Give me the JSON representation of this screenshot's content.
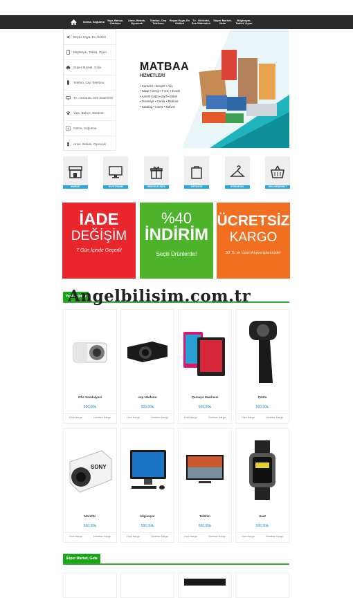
{
  "nav": {
    "items": [
      {
        "label": "Isıtma, Soğutma"
      },
      {
        "label": "Yapı, Bahçe, Outdoor"
      },
      {
        "label": "Anne, Bebek, Oyuncak"
      },
      {
        "label": "Telefon, Cep Telefonu"
      },
      {
        "label": "Beyaz Eşya, Ev Aletleri"
      },
      {
        "label": "Tv , Görüntü, Ses Sistemleri"
      },
      {
        "label": "Süper Market, Gıda"
      },
      {
        "label": "Bilgisayar, Tablet, Oyun"
      }
    ]
  },
  "sidebar": {
    "items": [
      {
        "label": "Beyaz Eşya, Ev Aletleri",
        "icon": "plane-icon"
      },
      {
        "label": "Bilgisayar, Tablet, Oyun",
        "icon": "tablet-icon"
      },
      {
        "label": "Süper Market, Gıda",
        "icon": "car-icon"
      },
      {
        "label": "Telefon, Cep Telefonu",
        "icon": "phone-icon"
      },
      {
        "label": "Tv , Görüntü, Ses Sistemleri",
        "icon": "tv-icon"
      },
      {
        "label": "Yapı, Bahçe, Outdoor",
        "icon": "paw-icon"
      },
      {
        "label": "Isıtma, Soğutma",
        "icon": "fireplace-icon"
      },
      {
        "label": "Anne, Bebek, Oyuncak",
        "icon": "baby-icon"
      }
    ]
  },
  "banner": {
    "title": "MATBAA",
    "subtitle": "HİZMETLERİ",
    "lines": [
      "• Kartvizit • Broşür • Afiş",
      "• Kitap • Dergi • Form • Evrak",
      "• Antetli Kağıt • Zarf • Etiket",
      "• Davetiye • Çanta • Bloknot",
      "• Katalog • Insert • Takvim"
    ]
  },
  "categories": [
    {
      "label": "MARKET",
      "icon": "store-icon"
    },
    {
      "label": "ELEKTRONİK",
      "icon": "monitor-icon"
    },
    {
      "label": "HEDİYELİK EŞYA",
      "icon": "gift-icon"
    },
    {
      "label": "KIRTASİYE",
      "icon": "bag-icon"
    },
    {
      "label": "GİYİM MODA",
      "icon": "hanger-icon"
    },
    {
      "label": "GIDA MEŞRUBAT",
      "icon": "basket-icon"
    }
  ],
  "promos": [
    {
      "a": "İADE",
      "b": "DEĞİŞİM",
      "c": "7 Gün İçinde Geçerli!",
      "color": "#e8262b"
    },
    {
      "a": "%40",
      "b": "İNDİRİM",
      "c": "Seçili Ürünlerde!",
      "color": "#4db32a"
    },
    {
      "a": "ÜCRETSİZ",
      "b": "KARGO",
      "c": "50 TL ve Üzeri Alışverişlerinizde!",
      "color": "#f26f22"
    }
  ],
  "watermark": "Angelbilisim.com.tr",
  "section1": {
    "title": "Yeni Ürünler"
  },
  "section2": {
    "title": "Süper Market, Gıda"
  },
  "products": [
    {
      "name": "Ofis Sandalyesi",
      "price": "500,00₺",
      "a": "Hızlı Kargo",
      "b": "Ücretsiz Kargo",
      "img": "camera-icon"
    },
    {
      "name": "cep telefonu",
      "price": "500,00₺",
      "a": "Hızlı Kargo",
      "b": "Ücretsiz Kargo",
      "img": "projector-icon"
    },
    {
      "name": "Çamaşır Makinesi",
      "price": "500,00₺",
      "a": "Hızlı Kargo",
      "b": "Ücretsiz Kargo",
      "img": "tablets-icon"
    },
    {
      "name": "Çanta",
      "price": "500,00₺",
      "a": "Hızlı Kargo",
      "b": "Ücretsiz Kargo",
      "img": "webcam-icon"
    },
    {
      "name": "Monitör",
      "price": "500,00₺",
      "a": "Hızlı Kargo",
      "b": "Ücretsiz Kargo",
      "img": "action-camera-icon"
    },
    {
      "name": "bilgisayar",
      "price": "590,00₺",
      "a": "Hızlı Kargo",
      "b": "Ücretsiz Kargo",
      "img": "all-in-one-pc-icon"
    },
    {
      "name": "Telefon",
      "price": "500,00₺",
      "a": "Hızlı Kargo",
      "b": "Ücretsiz Kargo",
      "img": "tv-icon"
    },
    {
      "name": "Saat",
      "price": "500,00₺",
      "a": "Hızlı Kargo",
      "b": "Ücretsiz Kargo",
      "img": "smartwatch-icon"
    }
  ]
}
